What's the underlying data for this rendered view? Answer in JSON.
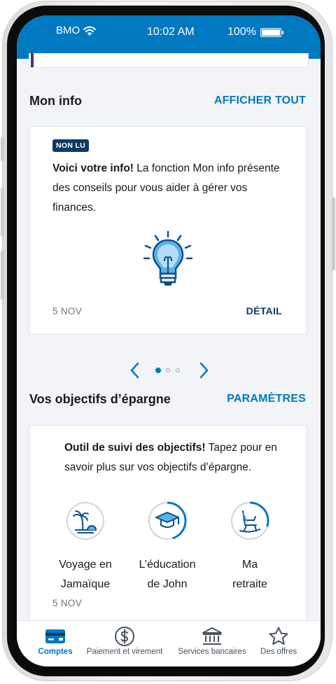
{
  "status_bar": {
    "carrier": "BMO",
    "time": "10:02 AM",
    "battery": "100%"
  },
  "mon_info": {
    "title": "Mon info",
    "link": "AFFICHER TOUT",
    "badge": "NON LU",
    "message_bold": "Voici votre info!",
    "message_rest": " La fonction Mon info présente des conseils pour vous aider à gérer vos finances.",
    "date": "5 NOV",
    "detail": "DÉTAIL",
    "carousel": {
      "pages": 3,
      "current": 1
    }
  },
  "objectifs": {
    "title": "Vos objectifs d’épargne",
    "link": "PARAMÈTRES",
    "intro_bold": "Outil de suivi des objectifs!",
    "intro_rest": " Tapez pour en savoir plus sur vos objectifs d’épargne.",
    "goals": [
      {
        "line1": "Voyage en",
        "line2": "Jamaïque",
        "icon": "beach-palm-icon",
        "progress": 0.0
      },
      {
        "line1": "L’éducation",
        "line2": "de John",
        "icon": "graduation-cap-icon",
        "progress": 0.45
      },
      {
        "line1": "Ma",
        "line2": "retraite",
        "icon": "rocking-chair-icon",
        "progress": 0.3
      }
    ],
    "date": "5 NOV"
  },
  "bottom_nav": {
    "items": [
      {
        "label": "Comptes",
        "icon": "card-icon",
        "active": true
      },
      {
        "label": "Paiement et virement",
        "icon": "dollar-circle-icon",
        "active": false
      },
      {
        "label": "Services bancaires",
        "icon": "bank-icon",
        "active": false
      },
      {
        "label": "Des offres",
        "icon": "star-icon",
        "active": false
      }
    ]
  },
  "colors": {
    "brand_blue": "#0079c1",
    "navy": "#0d3b66",
    "background": "#f2f4f7"
  }
}
